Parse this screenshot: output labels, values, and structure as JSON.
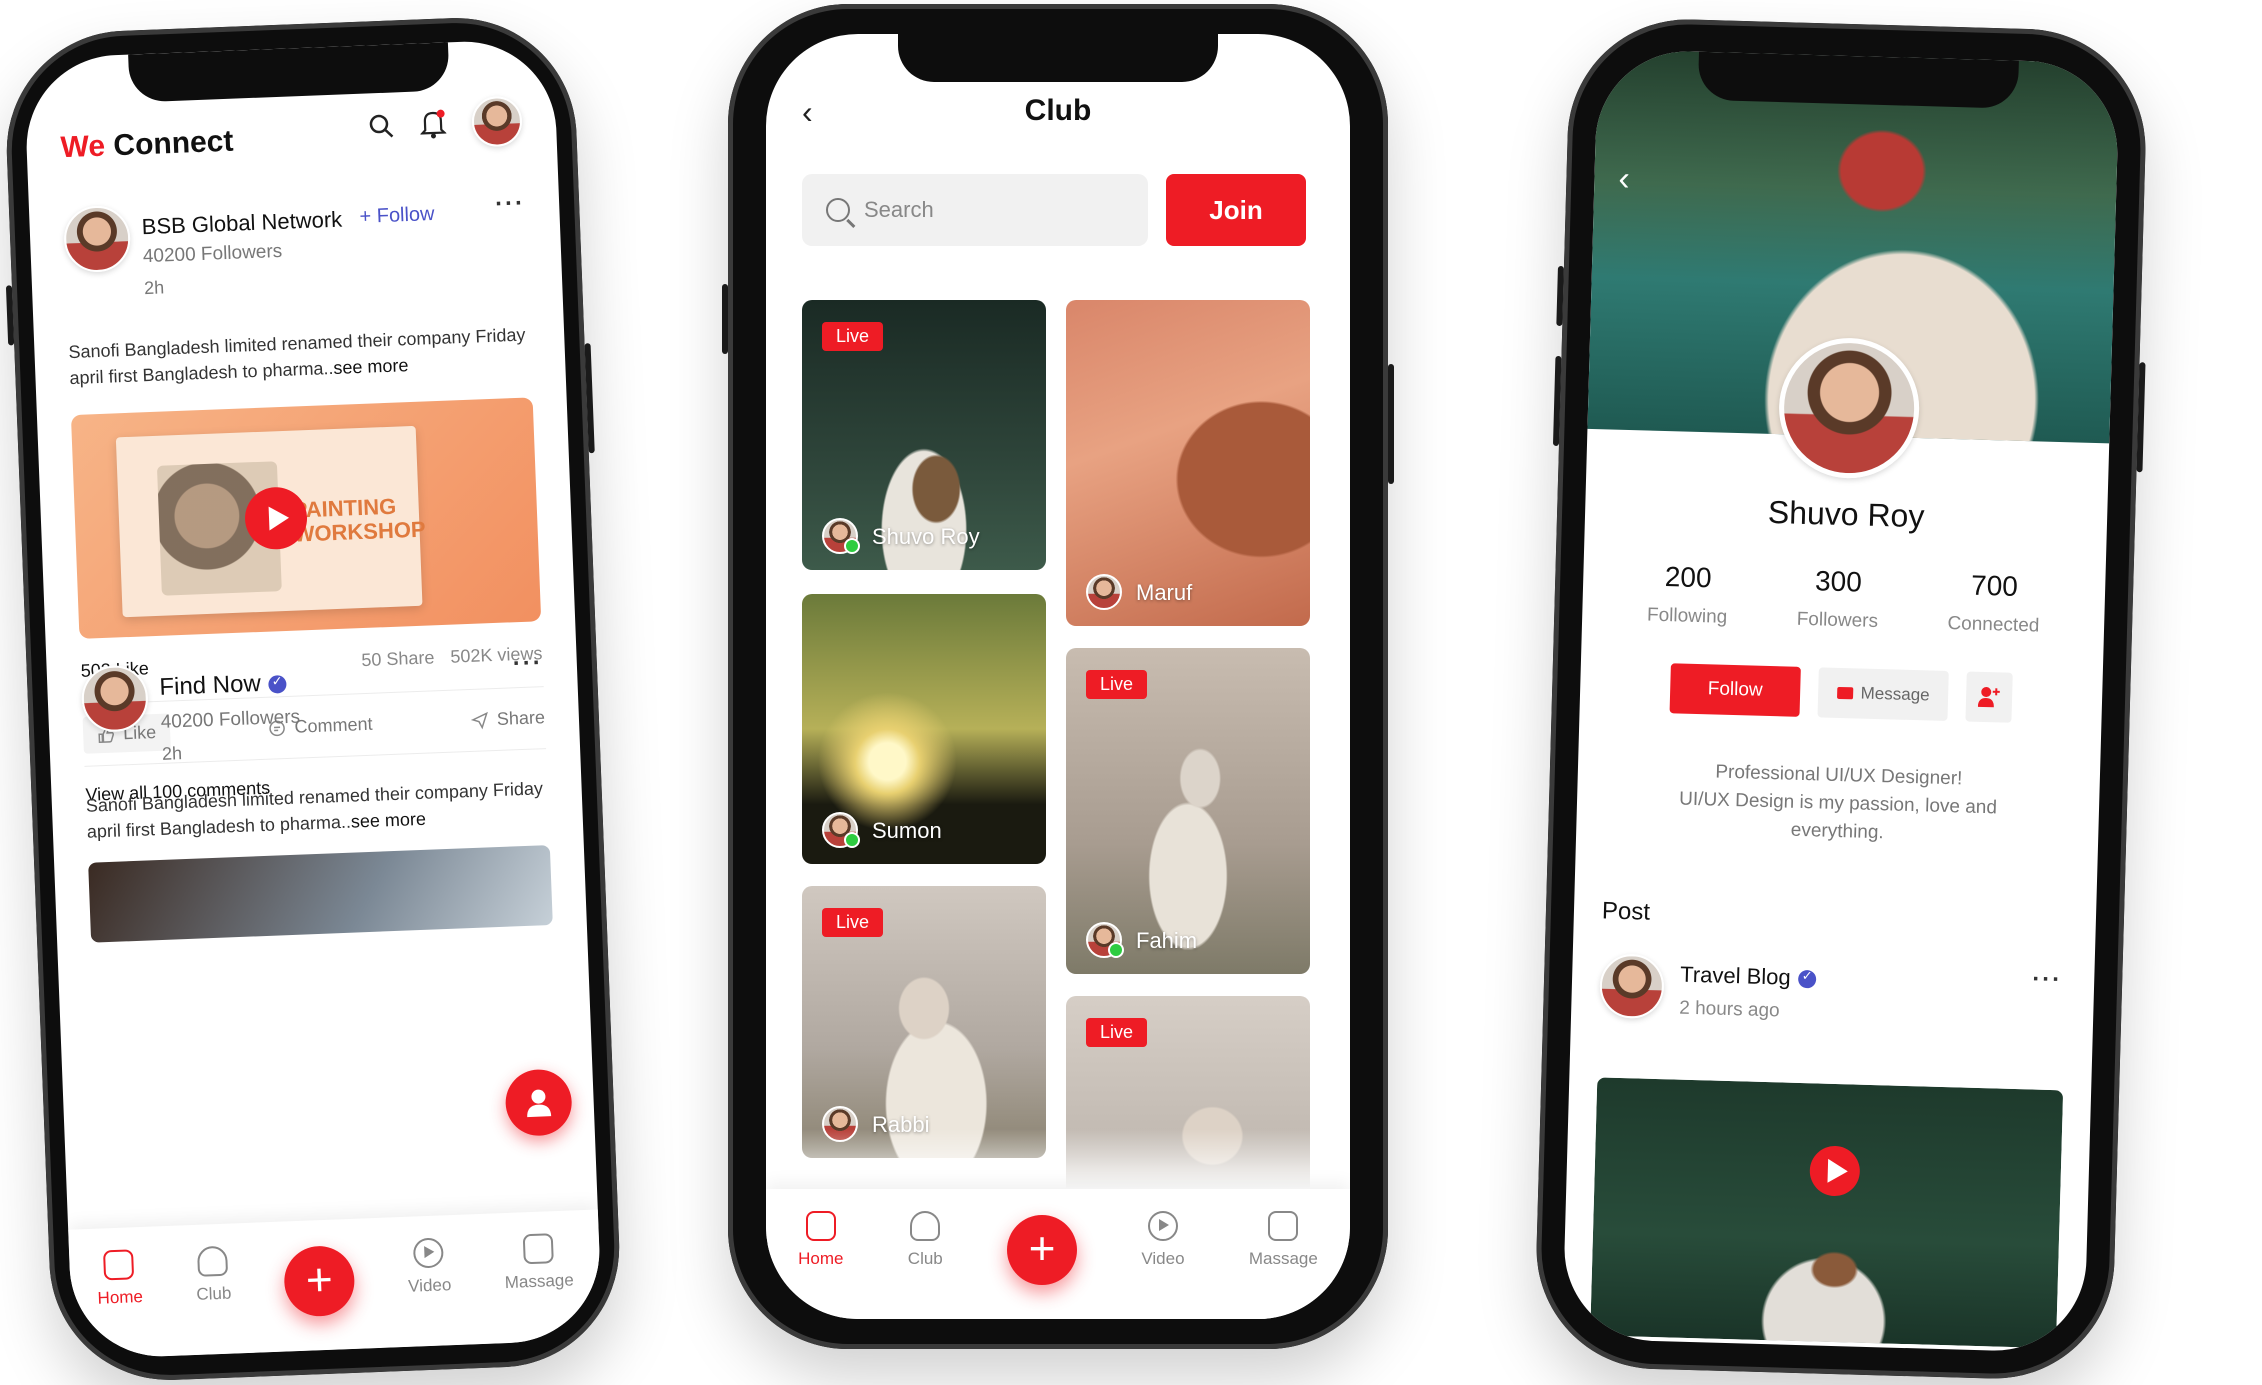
{
  "accent": "#ee1c25",
  "feed": {
    "brand_we": "We",
    "brand_connect": "Connect",
    "icons": [
      "search-icon",
      "bell-icon"
    ],
    "post1": {
      "name": "BSB Global Network",
      "follow": "+ Follow",
      "followers": "40200 Followers",
      "time": "2h",
      "text": "Sanofi Bangladesh limited renamed their company Friday april first Bangladesh to pharma..",
      "see_more": "see more",
      "media_title_line1": "PAINTING",
      "media_title_line2": "WORKSHOP",
      "likes": "502 Like",
      "shares": "50 Share",
      "views": "502K views",
      "action_like": "Like",
      "action_comment": "Comment",
      "action_share": "Share",
      "view_all": "View all 100 comments"
    },
    "post2": {
      "name": "Find Now",
      "followers": "40200 Followers",
      "time": "2h",
      "text": "Sanofi Bangladesh limited renamed their company Friday april first Bangladesh to pharma..",
      "see_more": "see more"
    }
  },
  "tabs": {
    "home": "Home",
    "club": "Club",
    "video": "Video",
    "message": "Massage"
  },
  "club": {
    "title": "Club",
    "search_placeholder": "Search",
    "join": "Join",
    "live_label": "Live",
    "tiles": {
      "shuvo": "Shuvo Roy",
      "maruf": "Maruf",
      "sumon": "Sumon",
      "fahim": "Fahim",
      "rabbi": "Rabbi"
    }
  },
  "profile": {
    "name": "Shuvo Roy",
    "following_count": "200",
    "following_label": "Following",
    "followers_count": "300",
    "followers_label": "Followers",
    "connected_count": "700",
    "connected_label": "Connected",
    "follow_btn": "Follow",
    "message_btn": "Message",
    "bio_line1": "Professional UI/UX Designer!",
    "bio_line2": "UI/UX Design is my passion, love and",
    "bio_line3": "everything.",
    "post_label": "Post",
    "post_name": "Travel Blog",
    "post_time": "2 hours ago"
  }
}
